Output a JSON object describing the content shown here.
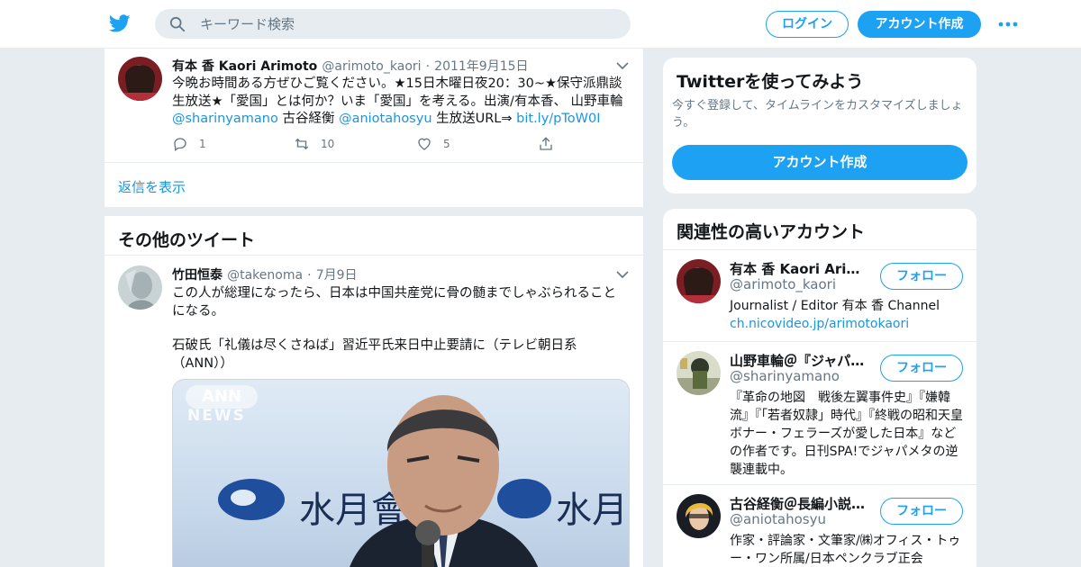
{
  "header": {
    "search_placeholder": "キーワード検索",
    "login_label": "ログイン",
    "signup_label": "アカウント作成"
  },
  "main_tweet": {
    "name": "有本 香 Kaori Arimoto",
    "handle": "@arimoto_kaori",
    "date": "2011年9月15日",
    "text_1": "今晩お時間ある方ぜひご覧ください。★15日木曜日夜20：30~★保守派鼎談生放送★「愛国」とは何か？いま「愛国」を考える。出演/有本香、 山野車輪 ",
    "mention_1": "@sharinyamano",
    "text_2": " 古谷経衡 ",
    "mention_2": "@aniotahosyu",
    "text_3": " 生放送URL⇒ ",
    "url": "bit.ly/pToW0I",
    "replies": "1",
    "retweets": "10",
    "likes": "5"
  },
  "show_replies": "返信を表示",
  "more_tweets_title": "その他のツイート",
  "second_tweet": {
    "name": "竹田恒泰",
    "handle": "@takenoma",
    "date": "7月9日",
    "text_1": "この人が総理になったら、日本は中国共産党に骨の髄までしゃぶられることになる。",
    "text_2": "石破氏「礼儀は尽くさねば」習近平氏来日中止要請に（テレビ朝日系（ANN））",
    "media_logo_1": "ANN",
    "media_logo_2": "NEWS",
    "media_sign_1": "水月會",
    "media_sign_2": "水月"
  },
  "signup_card": {
    "title": "Twitterを使ってみよう",
    "desc": "今すぐ登録して、タイムラインをカスタマイズしましょう。",
    "button": "アカウント作成"
  },
  "related": {
    "title": "関連性の高いアカウント",
    "follow_label": "フォロー",
    "accounts": [
      {
        "name": "有本 香 Kaori Arimoto",
        "handle": "@arimoto_kaori",
        "bio": "Journalist / Editor 有本 香 Channel",
        "link": "ch.nicovideo.jp/arimotokaori"
      },
      {
        "name": "山野車輪＠『ジャパ…",
        "handle": "@sharinyamano",
        "bio": "『革命の地図　戦後左翼事件史』『嫌韓流』『「若者奴隷」時代』『終戦の昭和天皇 ボナー・フェラーズが愛した日本』などの作者です。日刊SPA!でジャパメタの逆襲連載中。"
      },
      {
        "name": "古谷経衡＠長編小説…",
        "handle": "@aniotahosyu",
        "bio": "作家・評論家・文筆家/㈱オフィス・トゥー・ワン所属/日本ペンクラブ正会"
      }
    ]
  },
  "colors": {
    "accent": "#1da1f2",
    "link": "#1b95e0",
    "muted": "#657786",
    "background": "#e6ecf0"
  }
}
